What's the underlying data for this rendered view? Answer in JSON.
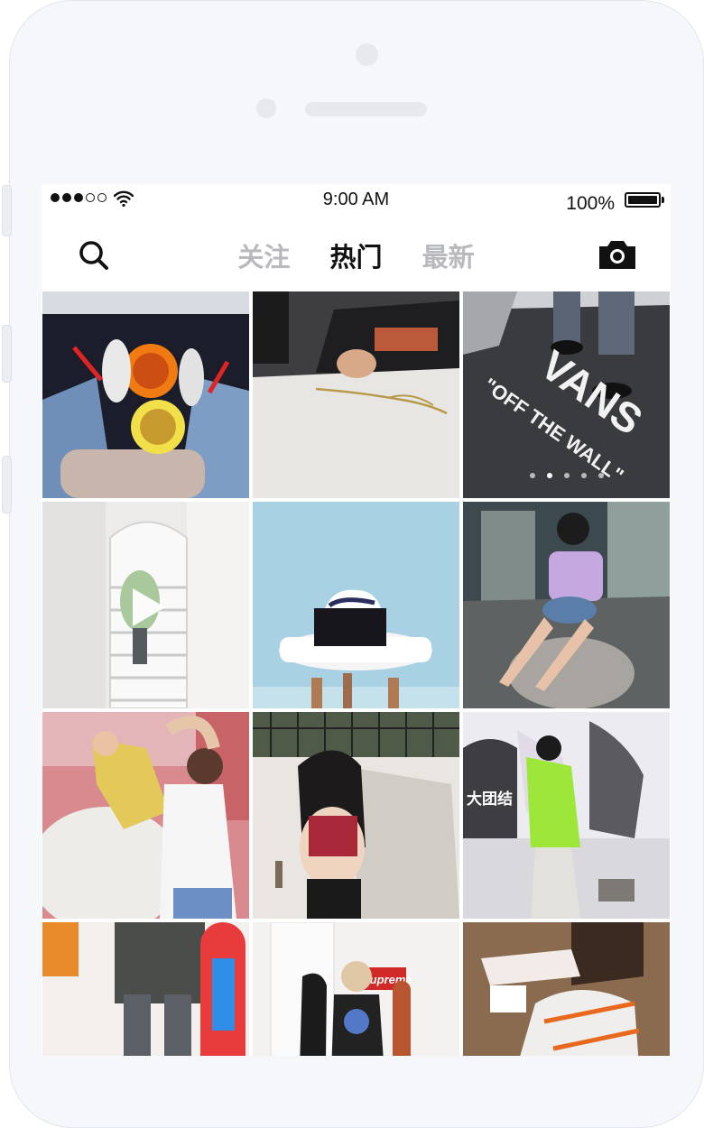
{
  "status_bar": {
    "time": "9:00 AM",
    "battery": "100%"
  },
  "navbar": {
    "tabs": [
      {
        "label": "关注",
        "active": false
      },
      {
        "label": "热门",
        "active": true
      },
      {
        "label": "最新",
        "active": false
      }
    ],
    "left_icon": "search-icon",
    "right_icon": "camera-icon"
  },
  "feed": {
    "posts": [
      {
        "type": "image",
        "description_icon": "photo"
      },
      {
        "type": "image",
        "description_icon": "photo"
      },
      {
        "type": "image",
        "description_icon": "photo",
        "overlay_text": [
          "VANS",
          "\"OFF THE WALL\""
        ],
        "carousel": {
          "count": 5,
          "current": 2
        }
      },
      {
        "type": "video",
        "description_icon": "play-icon"
      },
      {
        "type": "image",
        "description_icon": "photo"
      },
      {
        "type": "image",
        "description_icon": "photo"
      },
      {
        "type": "image",
        "description_icon": "photo"
      },
      {
        "type": "image",
        "description_icon": "photo"
      },
      {
        "type": "image",
        "description_icon": "photo",
        "overlay_text": [
          "大团结"
        ]
      },
      {
        "type": "image",
        "description_icon": "photo"
      },
      {
        "type": "image",
        "description_icon": "photo",
        "overlay_text": [
          "Supreme"
        ]
      },
      {
        "type": "image",
        "description_icon": "photo"
      }
    ]
  },
  "colors": {
    "active_tab": "#111111",
    "inactive_tab": "#b8b9bd",
    "phone_body": "#f6f7fb"
  }
}
